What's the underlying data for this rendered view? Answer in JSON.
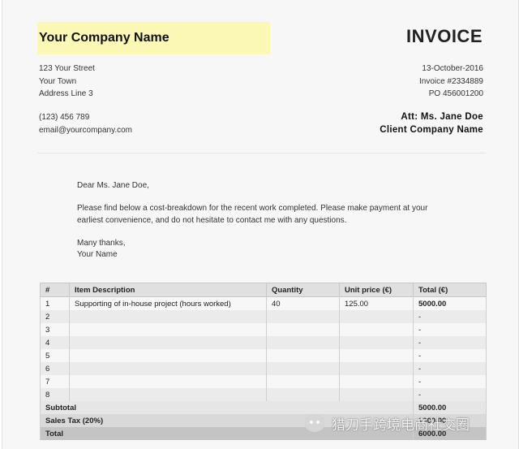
{
  "company": {
    "name": "Your Company Name",
    "address": [
      "123 Your Street",
      "Your Town",
      "Address Line 3"
    ],
    "phone": "(123) 456 789",
    "email": "email@yourcompany.com",
    "highlight_color": "#fbf8b6"
  },
  "invoice": {
    "title": "INVOICE",
    "date": "13-October-2016",
    "number": "Invoice #2334889",
    "po": "PO 456001200"
  },
  "client": {
    "att": "Att: Ms. Jane Doe",
    "company": "Client Company Name"
  },
  "letter": {
    "greeting": "Dear Ms. Jane Doe,",
    "body_line1": "Please find below a cost-breakdown for the recent work completed. Please make payment at your",
    "body_line2": "earliest convenience, and do not hesitate to contact me with any questions.",
    "closing": "Many thanks,",
    "signature": "Your Name"
  },
  "table": {
    "headers": [
      "#",
      "Item Description",
      "Quantity",
      "Unit price (€)",
      "Total (€)"
    ],
    "rows": [
      [
        "1",
        "Supporting of in-house project (hours worked)",
        "40",
        "125.00",
        "5000.00"
      ],
      [
        "2",
        "",
        "",
        "",
        "-"
      ],
      [
        "3",
        "",
        "",
        "",
        "-"
      ],
      [
        "4",
        "",
        "",
        "",
        "-"
      ],
      [
        "5",
        "",
        "",
        "",
        "-"
      ],
      [
        "6",
        "",
        "",
        "",
        "-"
      ],
      [
        "7",
        "",
        "",
        "",
        "-"
      ],
      [
        "8",
        "",
        "",
        "",
        "-"
      ]
    ],
    "subtotal_label": "Subtotal",
    "subtotal_value": "5000.00",
    "tax_label": "Sales Tax (20%)",
    "tax_value": "1000.00",
    "total_label": "Total",
    "total_value": "6000.00"
  },
  "watermark": {
    "text": "猎刀手跨境电商社交圈"
  }
}
